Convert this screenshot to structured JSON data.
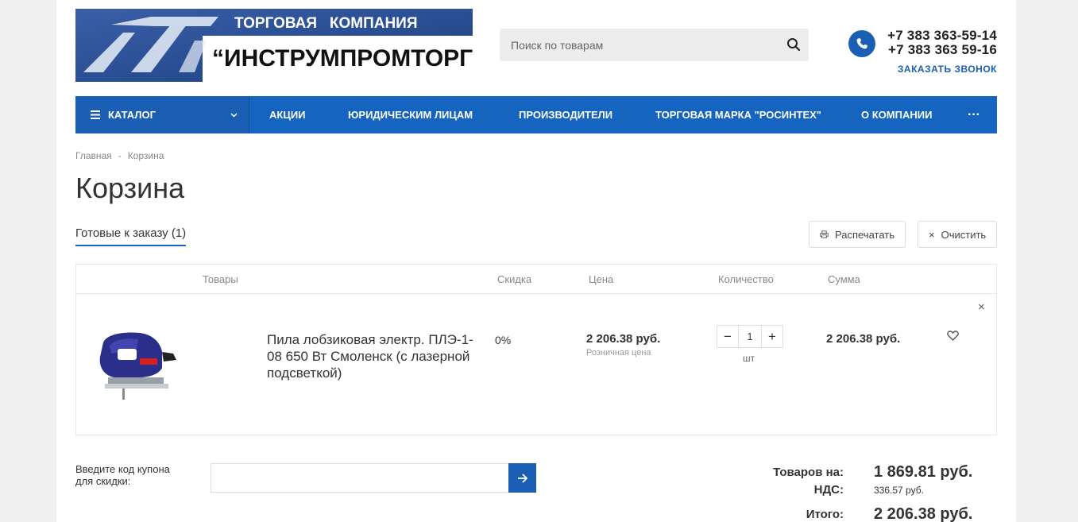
{
  "header": {
    "logo_top": "ТОРГОВАЯ   КОМПАНИЯ",
    "logo_main": "“ИНСТРУМПРОМТОРГ”",
    "search_placeholder": "Поиск по товарам",
    "phone1": "+7 383 363-59-14",
    "phone2": "+7 383 363 59-16",
    "callback": "ЗАКАЗАТЬ ЗВОНОК"
  },
  "nav": {
    "catalog": "КАТАЛОГ",
    "items": [
      "АКЦИИ",
      "ЮРИДИЧЕСКИМ ЛИЦАМ",
      "ПРОИЗВОДИТЕЛИ",
      "ТОРГОВАЯ МАРКА \"РОСИНТЕХ\"",
      "О КОМПАНИИ"
    ],
    "more": "···"
  },
  "breadcrumb": {
    "home": "Главная",
    "sep": "-",
    "current": "Корзина"
  },
  "page_title": "Корзина",
  "tab_label": "Готовые к заказу (1)",
  "buttons": {
    "print": "Распечатать",
    "clear": "Очистить"
  },
  "table": {
    "headers": {
      "goods": "Товары",
      "discount": "Скидка",
      "price": "Цена",
      "quantity": "Количество",
      "sum": "Сумма"
    },
    "rows": [
      {
        "name": "Пила лобзиковая электр. ПЛЭ-1-08 650 Вт Смоленск (с лазерной подсветкой)",
        "discount": "0%",
        "price": "2 206.38 руб.",
        "price_type": "Розничная цена",
        "quantity": "1",
        "unit": "шт",
        "sum": "2 206.38 руб."
      }
    ]
  },
  "coupon": {
    "label_line1": "Введите код купона",
    "label_line2": "для скидки:"
  },
  "totals": {
    "goods_label": "Товаров на:",
    "goods_value": "1 869.81 руб.",
    "vat_label": "НДС:",
    "vat_value": "336.57 руб.",
    "total_label": "Итого:",
    "total_value": "2 206.38 руб."
  },
  "colors": {
    "primary": "#1565c0",
    "nav_dark": "#1a5fb4"
  }
}
